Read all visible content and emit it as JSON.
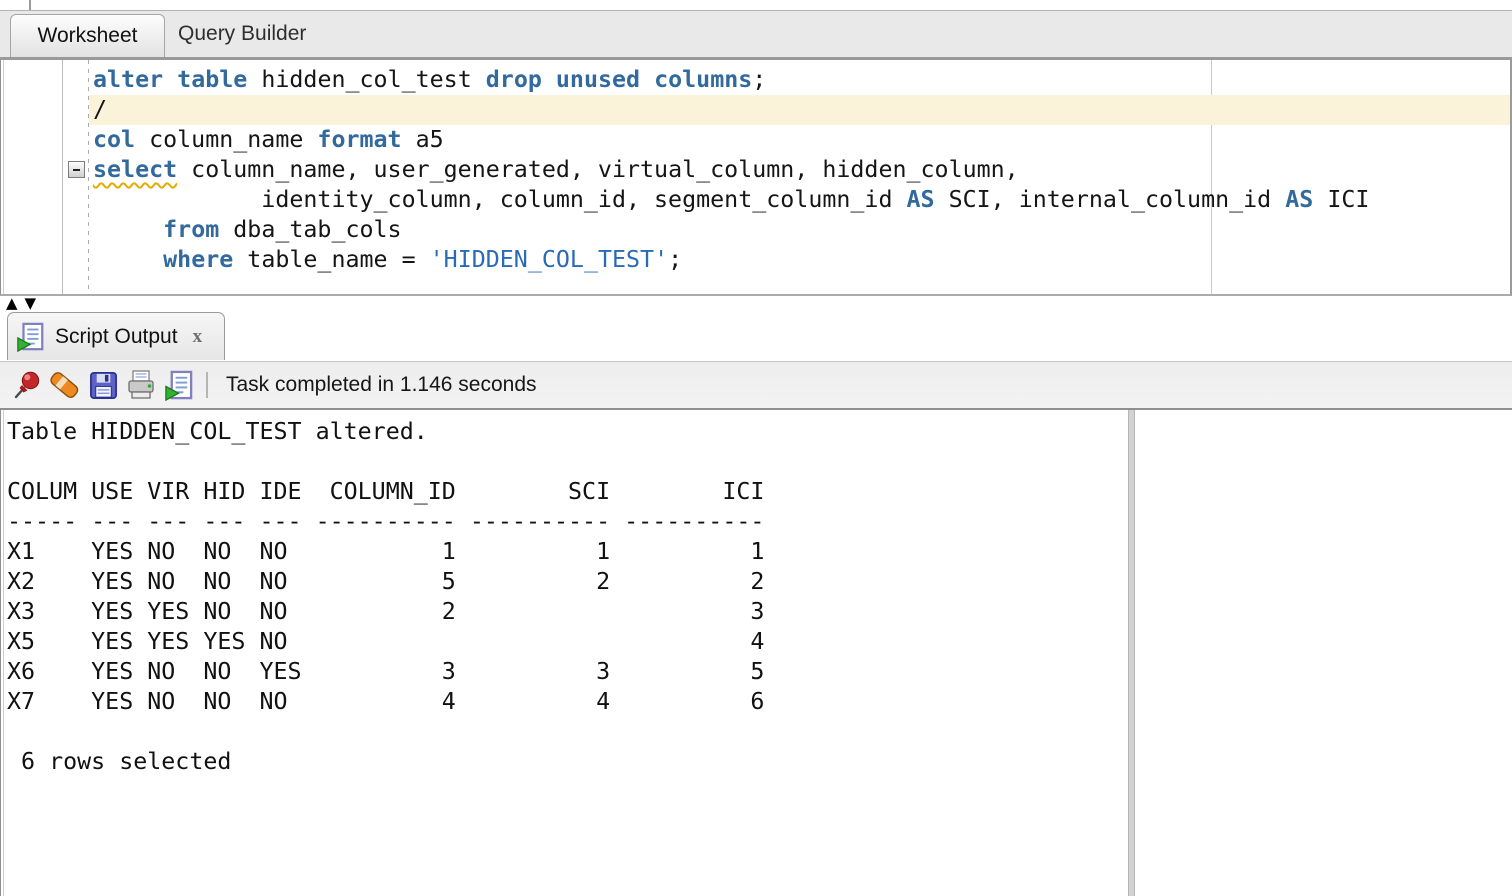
{
  "colors": {
    "keyword": "#336a9e",
    "string": "#2a6bb5",
    "current_line_highlight": "#fbf3d9",
    "error_underline": "#e3ac00",
    "tab_bar_bg": "#e9e9e9",
    "toolbar_bg": "#ededed"
  },
  "worksheet_tabs": {
    "worksheet": "Worksheet",
    "query_builder": "Query Builder"
  },
  "editor": {
    "lines": [
      {
        "tokens": [
          [
            "kw",
            "alter"
          ],
          [
            "pl",
            " "
          ],
          [
            "kw",
            "table"
          ],
          [
            "pl",
            " hidden_col_test "
          ],
          [
            "kw",
            "drop"
          ],
          [
            "pl",
            " "
          ],
          [
            "kw",
            "unused"
          ],
          [
            "pl",
            " "
          ],
          [
            "kw",
            "columns"
          ],
          [
            "pl",
            ";"
          ]
        ]
      },
      {
        "highlight": true,
        "tokens": [
          [
            "pl",
            "/"
          ]
        ]
      },
      {
        "tokens": [
          [
            "kw",
            "col"
          ],
          [
            "pl",
            " column_name "
          ],
          [
            "kw",
            "format"
          ],
          [
            "pl",
            " a5"
          ]
        ]
      },
      {
        "fold": true,
        "tokens": [
          [
            "kwu",
            "select"
          ],
          [
            "pl",
            " column_name, user_generated, virtual_column, hidden_column,"
          ]
        ]
      },
      {
        "tokens": [
          [
            "pl",
            "            identity_column, column_id, segment_column_id "
          ],
          [
            "kw",
            "AS"
          ],
          [
            "pl",
            " SCI, internal_column_id "
          ],
          [
            "kw",
            "AS"
          ],
          [
            "pl",
            " ICI"
          ]
        ]
      },
      {
        "tokens": [
          [
            "pl",
            "     "
          ],
          [
            "kw",
            "from"
          ],
          [
            "pl",
            " dba_tab_cols"
          ]
        ]
      },
      {
        "tokens": [
          [
            "pl",
            "     "
          ],
          [
            "kw",
            "where"
          ],
          [
            "pl",
            " table_name = "
          ],
          [
            "str",
            "'HIDDEN_COL_TEST'"
          ],
          [
            "pl",
            ";"
          ]
        ]
      }
    ]
  },
  "splitter": {
    "up": "▲",
    "down": "▼"
  },
  "output_tab": {
    "icon": "run-script-icon",
    "label": "Script Output",
    "close": "x"
  },
  "toolbar": {
    "icons": [
      "pin-icon",
      "eraser-icon",
      "save-icon",
      "print-icon",
      "run-script-icon"
    ],
    "status": "Task completed in 1.146 seconds"
  },
  "output": {
    "lines": [
      "Table HIDDEN_COL_TEST altered.",
      "",
      "COLUM USE VIR HID IDE  COLUMN_ID        SCI        ICI",
      "----- --- --- --- --- ---------- ---------- ----------",
      "X1    YES NO  NO  NO           1          1          1",
      "X2    YES NO  NO  NO           5          2          2",
      "X3    YES YES NO  NO           2                     3",
      "X5    YES YES YES NO                                 4",
      "X6    YES NO  NO  YES          3          3          5",
      "X7    YES NO  NO  NO           4          4          6",
      "",
      " 6 rows selected"
    ],
    "table": {
      "columns": [
        "COLUM",
        "USE",
        "VIR",
        "HID",
        "IDE",
        "COLUMN_ID",
        "SCI",
        "ICI"
      ],
      "rows": [
        [
          "X1",
          "YES",
          "NO",
          "NO",
          "NO",
          "1",
          "1",
          "1"
        ],
        [
          "X2",
          "YES",
          "NO",
          "NO",
          "NO",
          "5",
          "2",
          "2"
        ],
        [
          "X3",
          "YES",
          "YES",
          "NO",
          "NO",
          "2",
          "",
          "3"
        ],
        [
          "X5",
          "YES",
          "YES",
          "YES",
          "NO",
          "",
          "",
          "4"
        ],
        [
          "X6",
          "YES",
          "NO",
          "NO",
          "YES",
          "3",
          "3",
          "5"
        ],
        [
          "X7",
          "YES",
          "NO",
          "NO",
          "NO",
          "4",
          "4",
          "6"
        ]
      ],
      "message_top": "Table HIDDEN_COL_TEST altered.",
      "message_bottom": "6 rows selected"
    }
  }
}
